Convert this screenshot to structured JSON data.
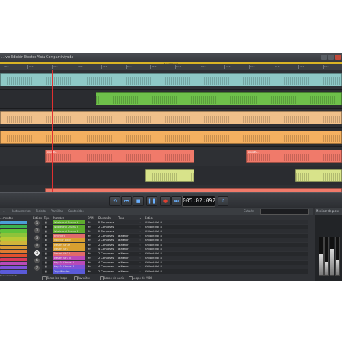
{
  "menu": {
    "items": [
      "...ivo",
      "Edición",
      "Efectos",
      "Vista",
      "Compartir",
      "Ayuda"
    ]
  },
  "ruler": {
    "label": "16 Compases",
    "ticks": [
      "16.1",
      "17.1",
      "18.1",
      "19.1",
      "20.1",
      "21.1",
      "22.1",
      "23.1",
      "24.1",
      "25.1",
      "26.1",
      "27.1",
      "28.1",
      "29.1"
    ]
  },
  "arranger": {
    "lanes": [
      {
        "color": "#8ec9c6",
        "clips": [
          [
            0,
            500,
            ""
          ]
        ]
      },
      {
        "color": "#6ec04a",
        "clips": [
          [
            140,
            360,
            ""
          ]
        ]
      },
      {
        "color": "#f0c08a",
        "clips": [
          [
            0,
            500,
            ""
          ]
        ]
      },
      {
        "color": "#f4b060",
        "clips": [
          [
            0,
            500,
            ""
          ]
        ]
      },
      {
        "color": "#f07a6a",
        "clips": [
          [
            66,
            218,
            "Arpeg Pa..."
          ],
          [
            360,
            140,
            "Arpeg Pa..."
          ]
        ]
      },
      {
        "color": "#d8e38a",
        "clips": [
          [
            212,
            72,
            ""
          ],
          [
            432,
            68,
            ""
          ]
        ]
      },
      {
        "color": "#f07a6a",
        "clips": [
          [
            66,
            434,
            ""
          ]
        ]
      },
      {
        "color": "#d8ee8a",
        "clips": [
          [
            0,
            30,
            ""
          ],
          [
            140,
            36,
            ""
          ],
          [
            286,
            36,
            ""
          ],
          [
            432,
            36,
            ""
          ]
        ]
      },
      {
        "color": "#b6e0b6",
        "clips": [
          [
            66,
            72,
            ""
          ],
          [
            212,
            108,
            ""
          ],
          [
            360,
            104,
            ""
          ]
        ]
      }
    ]
  },
  "transport": {
    "timecode": "005:02:092",
    "buttons": [
      "loop-icon",
      "rewind-icon",
      "stop-icon",
      "pause-icon",
      "record-icon",
      "forward-icon"
    ]
  },
  "lower": {
    "tabs": [
      "...",
      "Instrumentos",
      "Teclado",
      "Plantillas",
      "Contenidos"
    ],
    "search_label": "Catalán",
    "mixer_label": "Medidor de picos",
    "categories_header": "...mentos",
    "styles_header": "Estilos",
    "selection_label": "Seleccionar todo",
    "footer": "...M0 Loops"
  },
  "categories": [
    {
      "color": "#4b9fd6"
    },
    {
      "color": "#3cb34f"
    },
    {
      "color": "#5fc23b"
    },
    {
      "color": "#8ec33a"
    },
    {
      "color": "#b9c935"
    },
    {
      "color": "#d0b53a"
    },
    {
      "color": "#d89a35"
    },
    {
      "color": "#e07a30"
    },
    {
      "color": "#e0502e"
    },
    {
      "color": "#d83a5a"
    },
    {
      "color": "#b84ab8"
    },
    {
      "color": "#7f52d8"
    },
    {
      "color": "#5a5ad8"
    }
  ],
  "styles": [
    "1",
    "2",
    "3",
    "4",
    "5",
    "6",
    "7"
  ],
  "table": {
    "headers": {
      "tipo": "Tipo",
      "nombre": "Nombre",
      "bpm": "BPM",
      "duracion": "Duración",
      "tono": "Tono",
      "fav": "★",
      "estilo": "Estilo"
    },
    "rows": [
      {
        "nombre": "Wasteland Drums 1",
        "bpm": "90",
        "duracion": "2 Compases",
        "tono": "",
        "estilo": "Chillout Vol. 8",
        "color": "#5fae2e"
      },
      {
        "nombre": "Wasteland Drums 2",
        "bpm": "90",
        "duracion": "2 Compases",
        "tono": "",
        "estilo": "Chillout Vol. 8",
        "color": "#5fae2e"
      },
      {
        "nombre": "Wasteland Drums 3",
        "bpm": "90",
        "duracion": "2 Compases",
        "tono": "",
        "estilo": "Chillout Vol. 8",
        "color": "#5fae2e"
      },
      {
        "nombre": "Flying Fx",
        "bpm": "90",
        "duracion": "2 Compases",
        "tono": "a-Menor",
        "estilo": "Chillout Vol. 8",
        "color": "#e06a6a"
      },
      {
        "nombre": "Oblivion Edge",
        "bpm": "90",
        "duracion": "2 Compases",
        "tono": "a-Menor",
        "estilo": "Chillout Vol. 8",
        "color": "#d8a030"
      },
      {
        "nombre": "Desert Gtr3e",
        "bpm": "90",
        "duracion": "2 Compases",
        "tono": "a-Menor",
        "estilo": "Chillout Vol. 8",
        "color": "#d8a030"
      },
      {
        "nombre": "Desert Gtr3",
        "bpm": "90",
        "duracion": "4 Compases",
        "tono": "a-Menor",
        "estilo": "Chillout Vol. 8",
        "color": "#d8a030"
      },
      {
        "nombre": "Desert Gtr3 II",
        "bpm": "90",
        "duracion": "2 Compases",
        "tono": "a-Menor",
        "estilo": "Chillout Vol. 8",
        "color": "#e06a6a"
      },
      {
        "nombre": "Desert Gtr3 III",
        "bpm": "90",
        "duracion": "2 Compases",
        "tono": "a-Menor",
        "estilo": "Chillout Vol. 8",
        "color": "#b84ab8"
      },
      {
        "nombre": "Key Gr Chords A",
        "bpm": "90",
        "duracion": "4 Compases",
        "tono": "a-Menor",
        "estilo": "Chillout Vol. 8",
        "color": "#b84ab8"
      },
      {
        "nombre": "Key Gr Chords B",
        "bpm": "90",
        "duracion": "4 Compases",
        "tono": "a-Menor",
        "estilo": "Chillout Vol. 8",
        "color": "#7f52d8"
      },
      {
        "nombre": "Trap Wonder",
        "bpm": "90",
        "duracion": "2 Compases",
        "tono": "a-Menor",
        "estilo": "Chillout Vol. 8",
        "color": "#5a5ad8"
      }
    ]
  },
  "filters": [
    "Todos los loops",
    "Favoritos",
    "Loops de audio",
    "Loops de MIDI"
  ]
}
